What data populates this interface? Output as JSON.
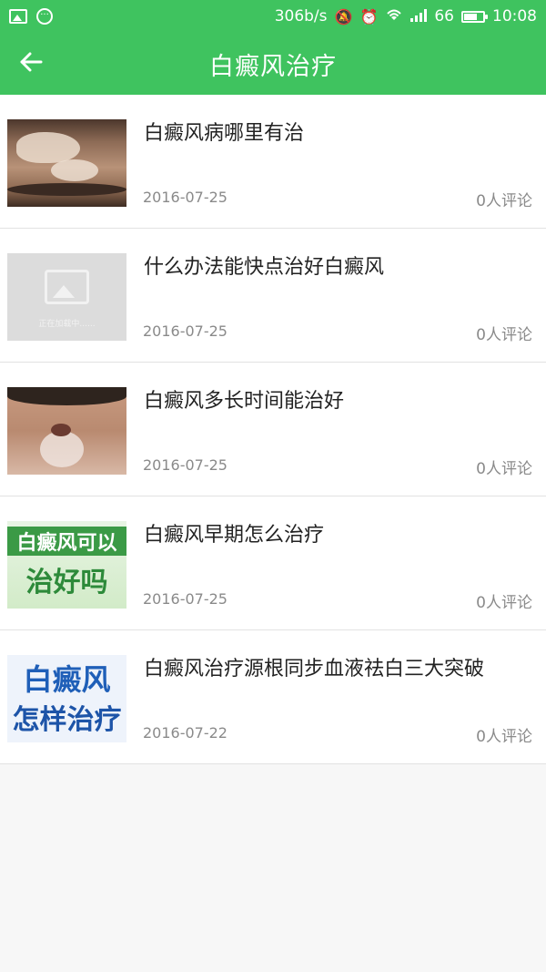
{
  "status_bar": {
    "network_speed": "306b/s",
    "signal": "66",
    "time": "10:08",
    "battery_level": 0.7,
    "icons": [
      "image-icon",
      "more-dots-icon",
      "mute-icon",
      "alarm-icon",
      "wifi-icon",
      "signal-icon",
      "battery-icon"
    ]
  },
  "header": {
    "title": "白癜风治疗",
    "back_icon": "arrow-left-icon"
  },
  "articles": [
    {
      "title": "白癜风病哪里有治",
      "date": "2016-07-25",
      "comments": "0人评论",
      "thumbnail": "skin-patch-photo"
    },
    {
      "title": "什么办法能快点治好白癜风",
      "date": "2016-07-25",
      "comments": "0人评论",
      "thumbnail": "loading-placeholder",
      "loading_text": "正在加载中......"
    },
    {
      "title": "白癜风多长时间能治好",
      "date": "2016-07-25",
      "comments": "0人评论",
      "thumbnail": "child-face-photo"
    },
    {
      "title": "白癜风早期怎么治疗",
      "date": "2016-07-25",
      "comments": "0人评论",
      "thumbnail": "green-text-banner",
      "thumb_line1": "白癜风可以",
      "thumb_line2": "治好吗"
    },
    {
      "title": "白癜风治疗源根同步血液祛白三大突破",
      "date": "2016-07-22",
      "comments": "0人评论",
      "thumbnail": "blue-text-banner",
      "thumb_line1": "白癜风",
      "thumb_line2": "怎样治疗"
    }
  ],
  "colors": {
    "accent": "#3fc35f",
    "title_text": "#222222",
    "meta_text": "#8a8a8a",
    "background": "#f7f7f7"
  }
}
